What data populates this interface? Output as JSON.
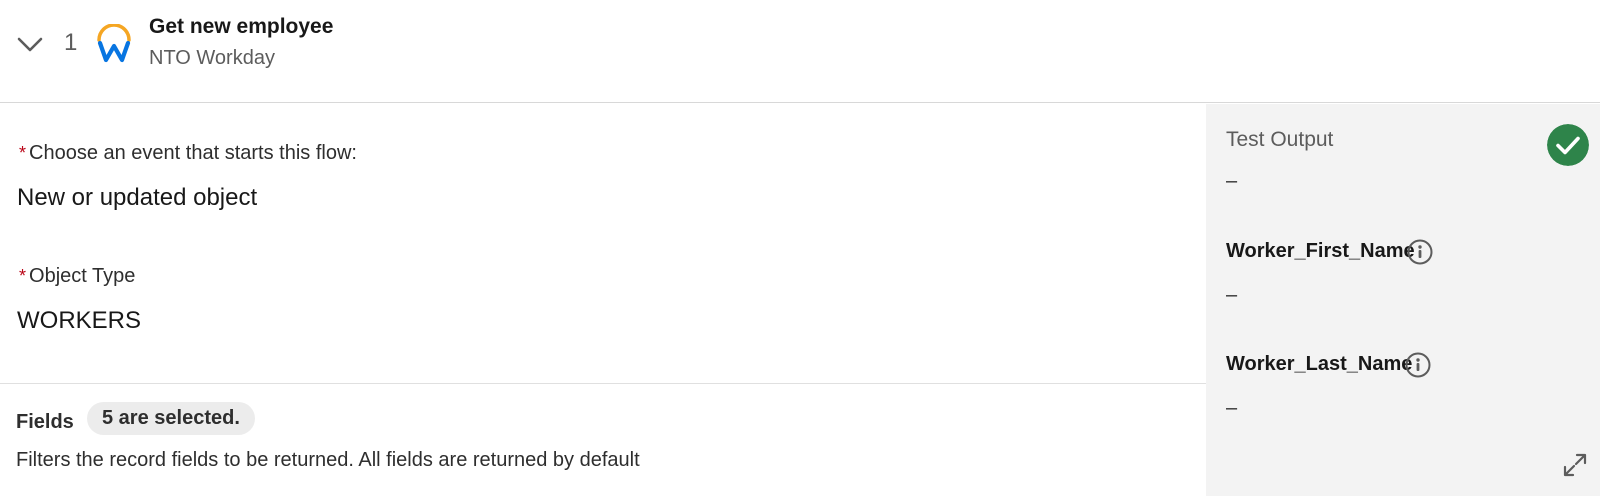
{
  "step": {
    "number": "1",
    "title": "Get new employee",
    "subtitle": "NTO Workday",
    "logo_icon": "workday-logo",
    "collapse_icon": "chevron-down-icon"
  },
  "config": {
    "required_mark": "*",
    "event_label": "Choose an event that starts this flow:",
    "event_value": "New or updated object",
    "object_type_label": "Object Type",
    "object_type_value": "WORKERS",
    "fields_label": "Fields",
    "fields_badge": "5 are selected.",
    "fields_help": "Filters the record fields to be returned. All fields are returned by default"
  },
  "test_output": {
    "title": "Test Output",
    "value": "–",
    "status_icon": "check-circle-icon",
    "status_color": "#2e844a",
    "fields": [
      {
        "name": "Worker_First_Name",
        "value": "–"
      },
      {
        "name": "Worker_Last_Name",
        "value": "–"
      }
    ],
    "expand_icon": "expand-icon"
  },
  "colors": {
    "required": "#ba0517",
    "panel_bg": "#f3f3f3",
    "logo_blue": "#0875e1",
    "logo_orange": "#f5a623"
  }
}
